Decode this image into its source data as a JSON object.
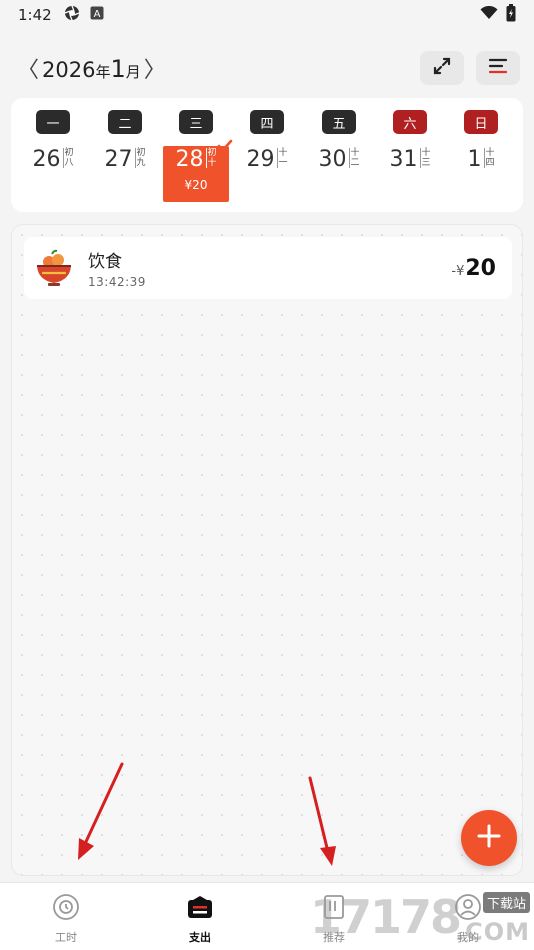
{
  "status_bar": {
    "time": "1:42",
    "icons": [
      "aperture-icon",
      "a-icon"
    ],
    "right_icons": [
      "wifi-icon",
      "battery-icon"
    ]
  },
  "header": {
    "prev_symbol": "〈",
    "next_symbol": "〉",
    "year": "2026",
    "year_unit": "年",
    "month": "1",
    "month_unit": "月",
    "expand_icon": "expand-icon",
    "menu_icon": "menu-icon"
  },
  "week": {
    "days": [
      {
        "weekday": "一",
        "date": "26",
        "lunar": "初八",
        "weekend": false
      },
      {
        "weekday": "二",
        "date": "27",
        "lunar": "初九",
        "weekend": false
      },
      {
        "weekday": "三",
        "date": "28",
        "lunar": "初十",
        "weekend": false,
        "selected": true,
        "amount": "¥20"
      },
      {
        "weekday": "四",
        "date": "29",
        "lunar": "十一",
        "weekend": false
      },
      {
        "weekday": "五",
        "date": "30",
        "lunar": "十二",
        "weekend": false
      },
      {
        "weekday": "六",
        "date": "31",
        "lunar": "十三",
        "weekend": true
      },
      {
        "weekday": "日",
        "date": "1",
        "lunar": "十四",
        "weekend": true
      }
    ]
  },
  "expenses": [
    {
      "category": "饮食",
      "time": "13:42:39",
      "sign": "-¥",
      "amount": "20",
      "icon": "food-bowl-icon"
    }
  ],
  "bottom_nav": {
    "items": [
      {
        "label": "工时",
        "icon": "clock-icon",
        "active": false
      },
      {
        "label": "支出",
        "icon": "wallet-icon",
        "active": true
      },
      {
        "label": "推荐",
        "icon": "recommend-icon",
        "active": false
      },
      {
        "label": "我的",
        "icon": "profile-icon",
        "active": false
      }
    ]
  },
  "watermark": {
    "digits": "17178",
    "site": "下载站",
    "domain": ".COM"
  },
  "colors": {
    "accent": "#f0532c",
    "weekend_badge": "#b02020",
    "weekday_badge": "#2b2b2b",
    "annotation_arrow": "#d42020"
  }
}
